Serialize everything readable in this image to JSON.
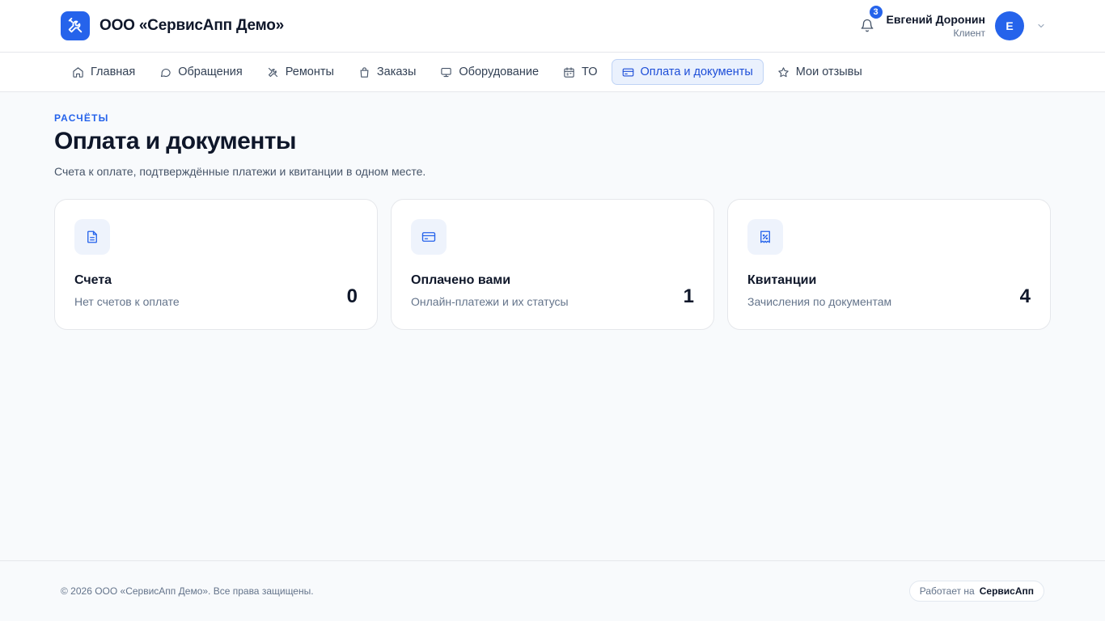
{
  "header": {
    "company_name": "ООО «СервисАпп Демо»",
    "notifications_count": "3",
    "user_name": "Евгений Доронин",
    "user_role": "Клиент",
    "avatar_initial": "Е"
  },
  "nav": {
    "items": [
      {
        "label": "Главная",
        "icon": "home-icon"
      },
      {
        "label": "Обращения",
        "icon": "chat-icon"
      },
      {
        "label": "Ремонты",
        "icon": "tools-icon"
      },
      {
        "label": "Заказы",
        "icon": "shopping-bag-icon"
      },
      {
        "label": "Оборудование",
        "icon": "monitor-icon"
      },
      {
        "label": "ТО",
        "icon": "calendar-icon"
      },
      {
        "label": "Оплата и документы",
        "icon": "credit-card-icon",
        "active": true
      },
      {
        "label": "Мои отзывы",
        "icon": "star-icon"
      }
    ]
  },
  "page": {
    "eyebrow": "РАСЧЁТЫ",
    "title": "Оплата и документы",
    "subtitle": "Счета к оплате, подтверждённые платежи и квитанции в одном месте."
  },
  "cards": [
    {
      "title": "Счета",
      "subtitle": "Нет счетов к оплате",
      "count": "0",
      "icon": "document-icon"
    },
    {
      "title": "Оплачено вами",
      "subtitle": "Онлайн-платежи и их статусы",
      "count": "1",
      "icon": "credit-card-icon"
    },
    {
      "title": "Квитанции",
      "subtitle": "Зачисления по документам",
      "count": "4",
      "icon": "receipt-icon"
    }
  ],
  "footer": {
    "copyright": "© 2026 ООО «СервисАпп Демо». Все права защищены.",
    "powered_by_label": "Работает на",
    "powered_by_brand": "СервисАпп"
  },
  "colors": {
    "accent": "#2563eb",
    "background": "#f8fafc",
    "nav_active_bg": "#eaf1fd"
  }
}
